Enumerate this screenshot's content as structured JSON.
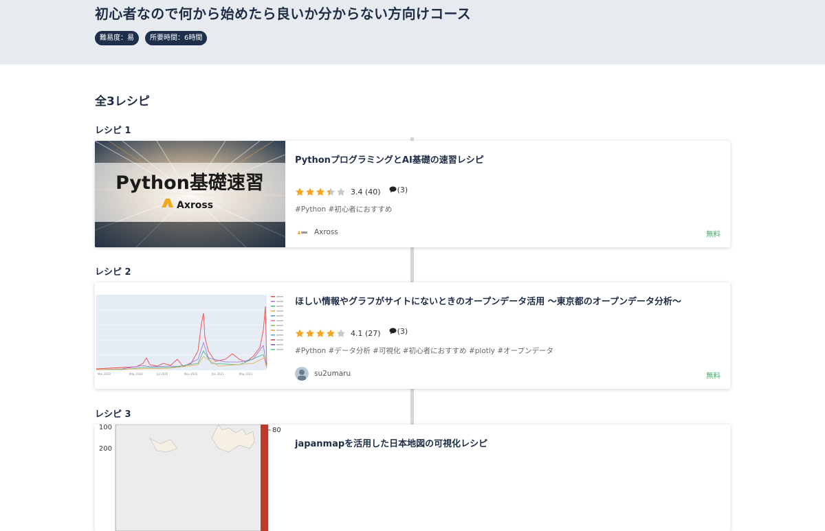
{
  "course": {
    "title": "初心者なので何から始めたら良いか分からない方向けコース",
    "difficulty": "難易度：易",
    "duration": "所要時間：6時間"
  },
  "recipes_count": "全3レシピ",
  "recipes": [
    {
      "label": "レシピ 1",
      "title": "PythonプログラミングとAI基礎の速習レシピ",
      "rating_value": 3.4,
      "rating_text": "3.4 (40)",
      "comments": "(3)",
      "tags": "#Python #初心者におすすめ",
      "author": "Axross",
      "price": "無料",
      "thumb_title": "Python基礎速習",
      "thumb_brand": "Axross"
    },
    {
      "label": "レシピ 2",
      "title": "ほしい情報やグラフがサイトにないときのオープンデータ活用 〜東京都のオープンデータ分析〜",
      "rating_value": 4.1,
      "rating_text": "4.1 (27)",
      "comments": "(3)",
      "tags": "#Python #データ分析 #可視化 #初心者におすすめ #plotly #オープンデータ",
      "author": "su2umaru",
      "price": "無料"
    },
    {
      "label": "レシピ 3",
      "title": "japanmapを活用した日本地図の可視化レシピ",
      "thumb_ticks": [
        "100",
        "200"
      ],
      "thumb_colorbar_tick": "80"
    }
  ],
  "colors": {
    "hero_bg": "#e7ebef",
    "badge_bg": "#1e2f4b",
    "star": "#f5a623",
    "star_empty": "#c8c8c8",
    "price": "#42b36a"
  }
}
